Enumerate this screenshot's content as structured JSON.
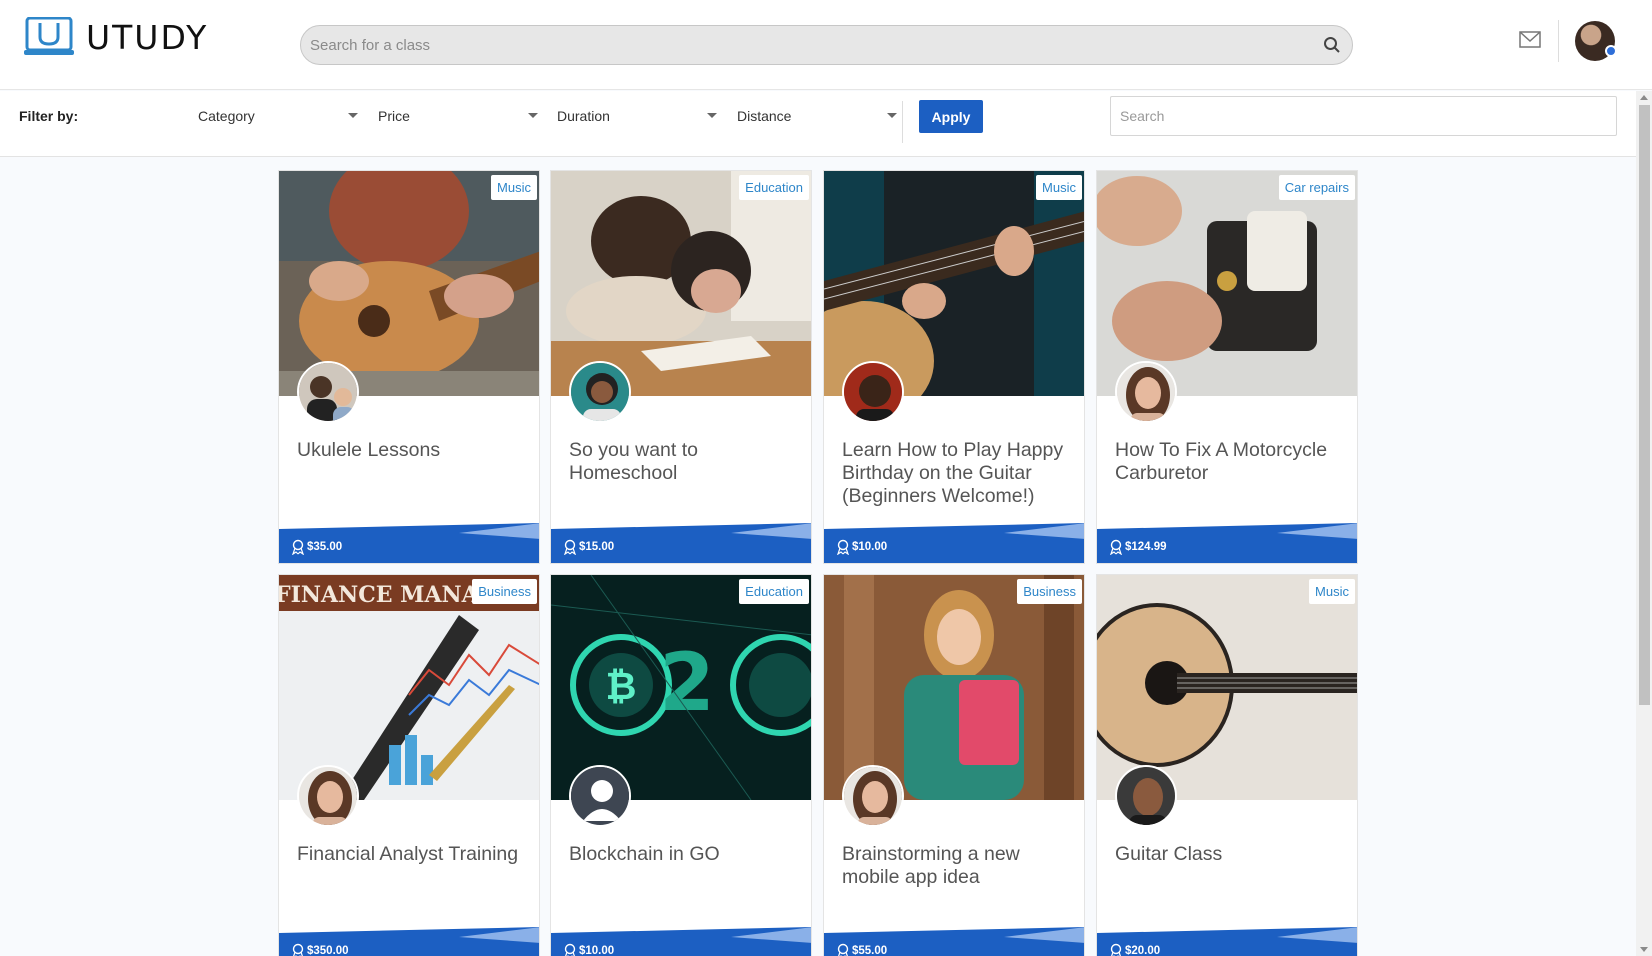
{
  "app": {
    "logo_text": "UTUDY",
    "search_placeholder": "Search for a class"
  },
  "filters": {
    "label": "Filter by:",
    "dropdowns": [
      {
        "label": "Category"
      },
      {
        "label": "Price"
      },
      {
        "label": "Duration"
      },
      {
        "label": "Distance"
      }
    ],
    "apply_label": "Apply",
    "search_placeholder": "Search"
  },
  "cards": [
    {
      "title": "Ukulele Lessons",
      "tag": "Music",
      "price": "$35.00",
      "image": "ukulele-photo",
      "author_avatar": "avatar-man-with-baby"
    },
    {
      "title": "So you want to Homeschool",
      "tag": "Education",
      "price": "$15.00",
      "image": "homeschool-photo",
      "author_avatar": "avatar-woman-smiling"
    },
    {
      "title": "Learn How to Play Happy Birthday on the Guitar (Beginners Welcome!)",
      "tag": "Music",
      "price": "$10.00",
      "image": "guitar-player-photo",
      "author_avatar": "avatar-man-red-background"
    },
    {
      "title": "How To Fix A Motorcycle Carburetor",
      "tag": "Car repairs",
      "price": "$124.99",
      "image": "carburetor-photo",
      "author_avatar": "avatar-woman-brown-hair"
    },
    {
      "title": "Financial Analyst Training",
      "tag": "Business",
      "price": "$350.00",
      "image": "finance-photo",
      "image_text": "FINANCE MANAGE",
      "author_avatar": "avatar-woman-brown-hair"
    },
    {
      "title": "Blockchain in GO",
      "tag": "Education",
      "price": "$10.00",
      "image": "bitcoin-photo",
      "author_avatar": "avatar-placeholder"
    },
    {
      "title": "Brainstorming a new mobile app idea",
      "tag": "Business",
      "price": "$55.00",
      "image": "student-photo",
      "author_avatar": "avatar-woman-brown-hair"
    },
    {
      "title": "Guitar Class",
      "tag": "Music",
      "price": "$20.00",
      "image": "acoustic-guitar-photo",
      "author_avatar": "avatar-man-smiling"
    }
  ],
  "colors": {
    "brand": "#1c5fc2",
    "tag_text": "#2e86c9",
    "logo": "#2e86c9"
  },
  "icons": {
    "header_search": "search-icon",
    "mail": "mail-icon",
    "price": "award-ribbon-icon"
  }
}
